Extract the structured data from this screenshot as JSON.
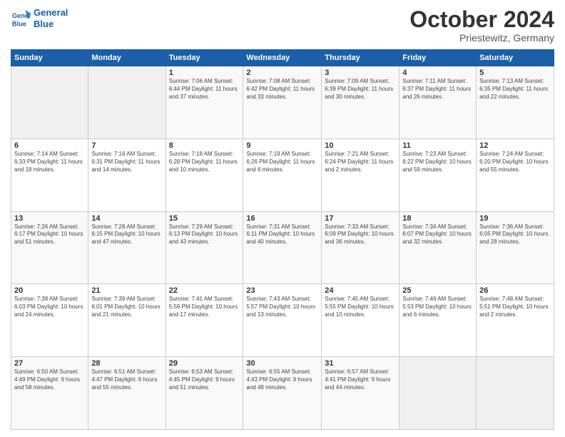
{
  "logo": {
    "line1": "General",
    "line2": "Blue"
  },
  "title": "October 2024",
  "location": "Priestewitz, Germany",
  "header_days": [
    "Sunday",
    "Monday",
    "Tuesday",
    "Wednesday",
    "Thursday",
    "Friday",
    "Saturday"
  ],
  "weeks": [
    [
      {
        "day": "",
        "info": ""
      },
      {
        "day": "",
        "info": ""
      },
      {
        "day": "1",
        "info": "Sunrise: 7:06 AM\nSunset: 6:44 PM\nDaylight: 11 hours and 37 minutes."
      },
      {
        "day": "2",
        "info": "Sunrise: 7:08 AM\nSunset: 6:42 PM\nDaylight: 11 hours and 33 minutes."
      },
      {
        "day": "3",
        "info": "Sunrise: 7:09 AM\nSunset: 6:39 PM\nDaylight: 11 hours and 30 minutes."
      },
      {
        "day": "4",
        "info": "Sunrise: 7:11 AM\nSunset: 6:37 PM\nDaylight: 11 hours and 26 minutes."
      },
      {
        "day": "5",
        "info": "Sunrise: 7:13 AM\nSunset: 6:35 PM\nDaylight: 11 hours and 22 minutes."
      }
    ],
    [
      {
        "day": "6",
        "info": "Sunrise: 7:14 AM\nSunset: 6:33 PM\nDaylight: 11 hours and 18 minutes."
      },
      {
        "day": "7",
        "info": "Sunrise: 7:16 AM\nSunset: 6:31 PM\nDaylight: 11 hours and 14 minutes."
      },
      {
        "day": "8",
        "info": "Sunrise: 7:18 AM\nSunset: 6:28 PM\nDaylight: 11 hours and 10 minutes."
      },
      {
        "day": "9",
        "info": "Sunrise: 7:19 AM\nSunset: 6:26 PM\nDaylight: 11 hours and 6 minutes."
      },
      {
        "day": "10",
        "info": "Sunrise: 7:21 AM\nSunset: 6:24 PM\nDaylight: 11 hours and 2 minutes."
      },
      {
        "day": "11",
        "info": "Sunrise: 7:23 AM\nSunset: 6:22 PM\nDaylight: 10 hours and 59 minutes."
      },
      {
        "day": "12",
        "info": "Sunrise: 7:24 AM\nSunset: 6:20 PM\nDaylight: 10 hours and 55 minutes."
      }
    ],
    [
      {
        "day": "13",
        "info": "Sunrise: 7:26 AM\nSunset: 6:17 PM\nDaylight: 10 hours and 51 minutes."
      },
      {
        "day": "14",
        "info": "Sunrise: 7:28 AM\nSunset: 6:15 PM\nDaylight: 10 hours and 47 minutes."
      },
      {
        "day": "15",
        "info": "Sunrise: 7:29 AM\nSunset: 6:13 PM\nDaylight: 10 hours and 43 minutes."
      },
      {
        "day": "16",
        "info": "Sunrise: 7:31 AM\nSunset: 6:11 PM\nDaylight: 10 hours and 40 minutes."
      },
      {
        "day": "17",
        "info": "Sunrise: 7:33 AM\nSunset: 6:09 PM\nDaylight: 10 hours and 36 minutes."
      },
      {
        "day": "18",
        "info": "Sunrise: 7:34 AM\nSunset: 6:07 PM\nDaylight: 10 hours and 32 minutes."
      },
      {
        "day": "19",
        "info": "Sunrise: 7:36 AM\nSunset: 6:05 PM\nDaylight: 10 hours and 28 minutes."
      }
    ],
    [
      {
        "day": "20",
        "info": "Sunrise: 7:38 AM\nSunset: 6:03 PM\nDaylight: 10 hours and 24 minutes."
      },
      {
        "day": "21",
        "info": "Sunrise: 7:39 AM\nSunset: 6:01 PM\nDaylight: 10 hours and 21 minutes."
      },
      {
        "day": "22",
        "info": "Sunrise: 7:41 AM\nSunset: 5:59 PM\nDaylight: 10 hours and 17 minutes."
      },
      {
        "day": "23",
        "info": "Sunrise: 7:43 AM\nSunset: 5:57 PM\nDaylight: 10 hours and 13 minutes."
      },
      {
        "day": "24",
        "info": "Sunrise: 7:45 AM\nSunset: 5:55 PM\nDaylight: 10 hours and 10 minutes."
      },
      {
        "day": "25",
        "info": "Sunrise: 7:46 AM\nSunset: 5:53 PM\nDaylight: 10 hours and 6 minutes."
      },
      {
        "day": "26",
        "info": "Sunrise: 7:48 AM\nSunset: 5:51 PM\nDaylight: 10 hours and 2 minutes."
      }
    ],
    [
      {
        "day": "27",
        "info": "Sunrise: 6:50 AM\nSunset: 4:49 PM\nDaylight: 9 hours and 58 minutes."
      },
      {
        "day": "28",
        "info": "Sunrise: 6:51 AM\nSunset: 4:47 PM\nDaylight: 9 hours and 55 minutes."
      },
      {
        "day": "29",
        "info": "Sunrise: 6:53 AM\nSunset: 4:45 PM\nDaylight: 9 hours and 51 minutes."
      },
      {
        "day": "30",
        "info": "Sunrise: 6:55 AM\nSunset: 4:43 PM\nDaylight: 9 hours and 48 minutes."
      },
      {
        "day": "31",
        "info": "Sunrise: 6:57 AM\nSunset: 4:41 PM\nDaylight: 9 hours and 44 minutes."
      },
      {
        "day": "",
        "info": ""
      },
      {
        "day": "",
        "info": ""
      }
    ]
  ]
}
